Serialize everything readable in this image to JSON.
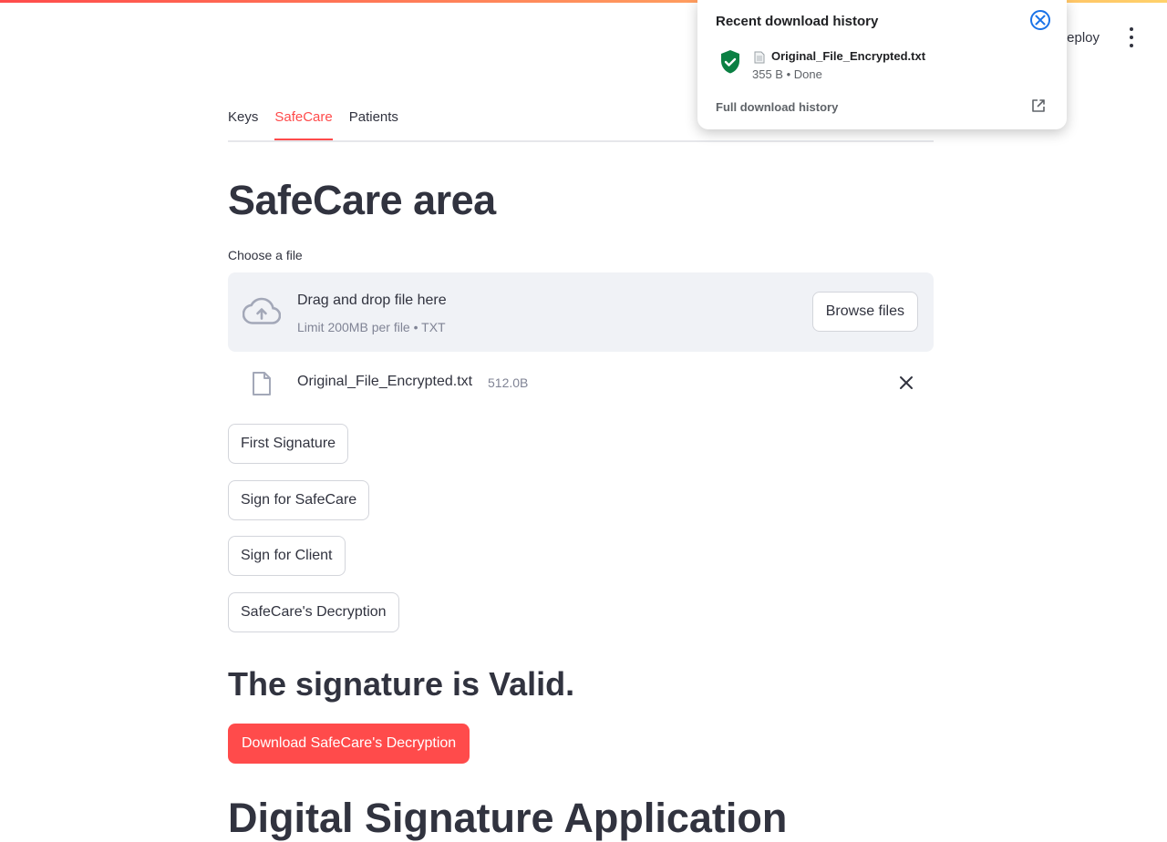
{
  "header": {
    "deploy_label": "eploy"
  },
  "tabs": [
    {
      "label": "Keys"
    },
    {
      "label": "SafeCare"
    },
    {
      "label": "Patients"
    }
  ],
  "main": {
    "title": "SafeCare area",
    "uploader": {
      "label": "Choose a file",
      "drop_text": "Drag and drop file here",
      "limit_text": "Limit 200MB per file • TXT",
      "browse_label": "Browse files"
    },
    "uploaded_file": {
      "name": "Original_File_Encrypted.txt",
      "size": "512.0B"
    },
    "buttons": {
      "first_signature": "First Signature",
      "sign_safecare": "Sign for SafeCare",
      "sign_client": "Sign for Client",
      "decryption": "SafeCare's Decryption"
    },
    "valid_message": "The signature is Valid.",
    "download_label": "Download SafeCare's Decryption",
    "next_heading": "Digital Signature Application"
  },
  "download_popup": {
    "title": "Recent download history",
    "item": {
      "filename": "Original_File_Encrypted.txt",
      "status": "355 B • Done"
    },
    "full_history_label": "Full download history"
  },
  "colors": {
    "accent": "#ff4b4b",
    "text": "#31333f",
    "muted": "#808495",
    "dropzone_bg": "#f0f2f6",
    "shield_green": "#0b8043",
    "popup_close_blue": "#1a73e8"
  }
}
